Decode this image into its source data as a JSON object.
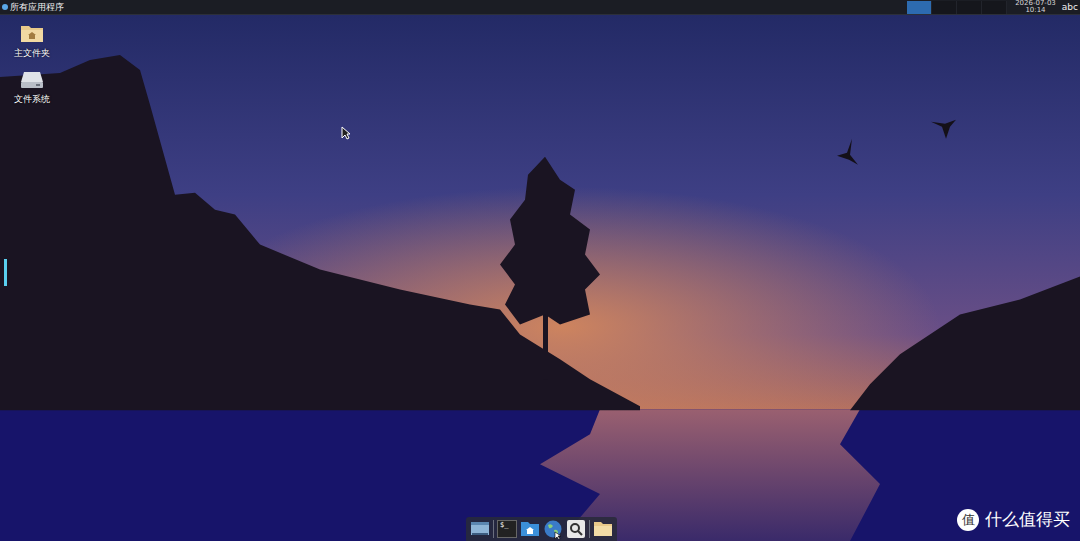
{
  "top_panel": {
    "menu_label": "所有应用程序",
    "workspaces": [
      {
        "selected": true
      },
      {
        "selected": false
      },
      {
        "selected": false
      },
      {
        "selected": false
      }
    ],
    "clock": {
      "date": "2026-07-03",
      "time": "10:14"
    },
    "input_method": "abc"
  },
  "desktop_icons": [
    {
      "label": "主文件夹",
      "kind": "home-folder"
    },
    {
      "label": "文件系统",
      "kind": "drive"
    }
  ],
  "dock": {
    "items": [
      {
        "kind": "show-desktop"
      },
      {
        "kind": "separator"
      },
      {
        "kind": "terminal",
        "glyph": "$_"
      },
      {
        "kind": "file-manager"
      },
      {
        "kind": "browser"
      },
      {
        "kind": "search"
      },
      {
        "kind": "separator"
      },
      {
        "kind": "folder"
      }
    ]
  },
  "watermark": {
    "logo": "值",
    "text": "什么值得买"
  }
}
